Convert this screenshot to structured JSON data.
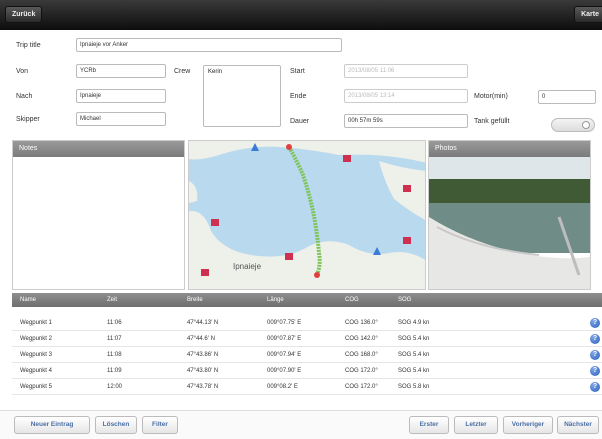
{
  "nav": {
    "back_label": "Zurück",
    "right_label": "Karte"
  },
  "form": {
    "trip_title_label": "Trip title",
    "trip_title_value": "Ipnaieje vor Anker",
    "von_label": "Von",
    "von_value": "YCRb",
    "nach_label": "Nach",
    "nach_value": "Ipnaieje",
    "skipper_label": "Skipper",
    "skipper_value": "Michael",
    "crew_label": "Crew",
    "crew_value": "Kerin",
    "start_label": "Start",
    "start_value": "2013/08/05 11:06",
    "ende_label": "Ende",
    "ende_value": "2013/08/05 13:14",
    "dauer_label": "Dauer",
    "dauer_value": "00h 57m 59s",
    "motor_label": "Motor(min)",
    "motor_value": "0",
    "tank_label": "Tank gefüllt",
    "tank_filled": false
  },
  "panels": {
    "notes_title": "Notes",
    "photos_title": "Photos",
    "map_label": "Ipnaieje"
  },
  "table": {
    "columns": [
      "Name",
      "Zeit",
      "Breite",
      "Länge",
      "COG",
      "SOG"
    ],
    "rows": [
      [
        "Wegpunkt 1",
        "11:06",
        "47°44.13' N",
        "009°07.75' E",
        "COG 136.0°",
        "SOG 4.9 kn"
      ],
      [
        "Wegpunkt 2",
        "11:07",
        "47°44.6' N",
        "009°07.87' E",
        "COG 142.0°",
        "SOG 5.4 kn"
      ],
      [
        "Wegpunkt 3",
        "11:08",
        "47°43.86' N",
        "009°07.94' E",
        "COG 168.0°",
        "SOG 5.4 kn"
      ],
      [
        "Wegpunkt 4",
        "11:09",
        "47°43.80' N",
        "009°07.90' E",
        "COG 172.0°",
        "SOG 5.4 kn"
      ],
      [
        "Wegpunkt 5",
        "12:00",
        "47°43.78' N",
        "009°08.2' E",
        "COG 172.0°",
        "SOG 5.8 kn"
      ]
    ]
  },
  "bottom": {
    "new_entry": "Neuer Eintrag",
    "delete": "Löschen",
    "filter": "Filter",
    "first": "Erster",
    "last": "Letzter",
    "previous": "Vorheriger",
    "next": "Nächster"
  },
  "colors": {
    "accent": "#4a6fa5",
    "header": "#7a7a7a",
    "water": "#b9d9ee",
    "land": "#eef0ea",
    "track": "#7dc45a"
  }
}
